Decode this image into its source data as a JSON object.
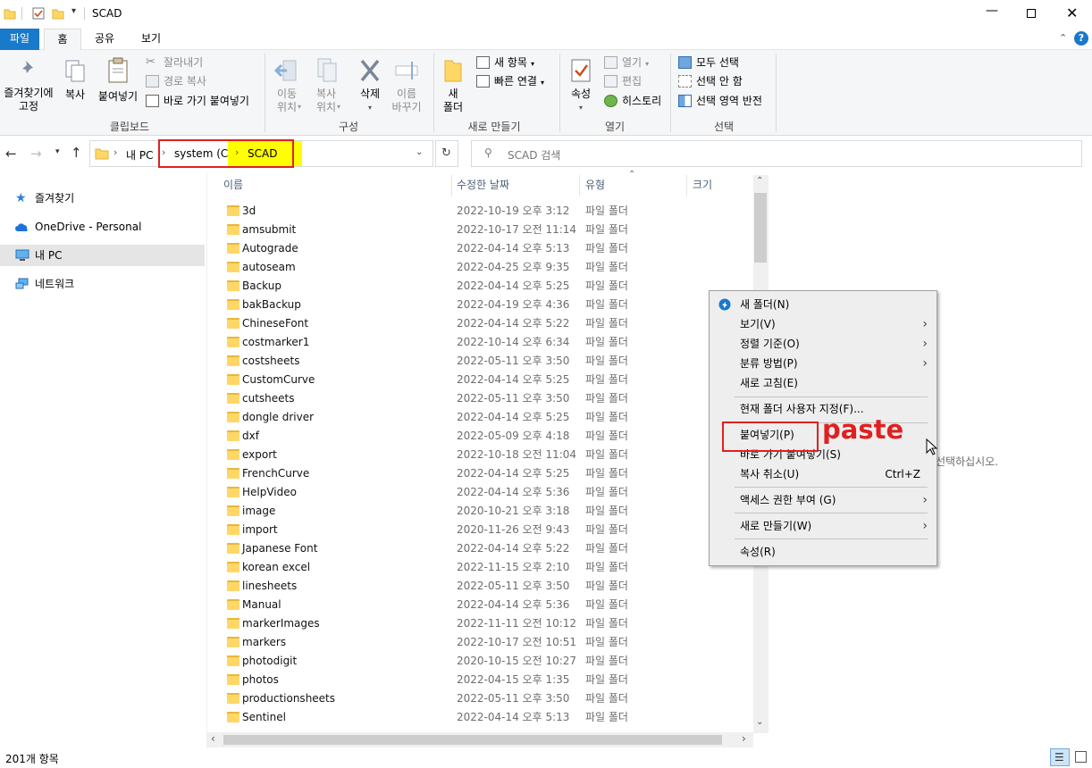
{
  "window": {
    "title": "SCAD"
  },
  "menu_tabs": [
    "파일",
    "홈",
    "공유",
    "보기"
  ],
  "ribbon": {
    "clipboard": {
      "pin": "즐겨찾기에\n고정",
      "copy": "복사",
      "paste": "붙여넣기",
      "cut": "잘라내기",
      "copy_path": "경로 복사",
      "paste_shortcut": "바로 가기 붙여넣기",
      "label": "클립보드"
    },
    "organize": {
      "move": "이동\n위치",
      "copy_to": "복사\n위치",
      "delete": "삭제",
      "rename": "이름\n바꾸기",
      "label": "구성"
    },
    "new": {
      "new_folder": "새\n폴더",
      "new_item": "새 항목",
      "easy_access": "빠른 연결",
      "label": "새로 만들기"
    },
    "open": {
      "properties": "속성",
      "open": "열기",
      "edit": "편집",
      "history": "히스토리",
      "label": "열기"
    },
    "select": {
      "select_all": "모두 선택",
      "select_none": "선택 안 함",
      "invert": "선택 영역 반전",
      "label": "선택"
    }
  },
  "address": {
    "pc": "내 PC",
    "drive": "system (C:)",
    "folder": "SCAD"
  },
  "search": {
    "placeholder": "SCAD 검색"
  },
  "sidebar": [
    {
      "label": "즐겨찾기",
      "icon": "star-icon"
    },
    {
      "label": "OneDrive - Personal",
      "icon": "cloud-icon"
    },
    {
      "label": "내 PC",
      "icon": "computer-icon"
    },
    {
      "label": "네트워크",
      "icon": "network-icon"
    }
  ],
  "columns": {
    "name": "이름",
    "date": "수정한 날짜",
    "type": "유형",
    "size": "크기"
  },
  "files": [
    {
      "name": "3d",
      "date": "2022-10-19 오후 3:12",
      "type": "파일 폴더"
    },
    {
      "name": "amsubmit",
      "date": "2022-10-17 오전 11:14",
      "type": "파일 폴더"
    },
    {
      "name": "Autograde",
      "date": "2022-04-14 오후 5:13",
      "type": "파일 폴더"
    },
    {
      "name": "autoseam",
      "date": "2022-04-25 오후 9:35",
      "type": "파일 폴더"
    },
    {
      "name": "Backup",
      "date": "2022-04-14 오후 5:25",
      "type": "파일 폴더"
    },
    {
      "name": "bakBackup",
      "date": "2022-04-19 오후 4:36",
      "type": "파일 폴더"
    },
    {
      "name": "ChineseFont",
      "date": "2022-04-14 오후 5:22",
      "type": "파일 폴더"
    },
    {
      "name": "costmarker1",
      "date": "2022-10-14 오후 6:34",
      "type": "파일 폴더"
    },
    {
      "name": "costsheets",
      "date": "2022-05-11 오후 3:50",
      "type": "파일 폴더"
    },
    {
      "name": "CustomCurve",
      "date": "2022-04-14 오후 5:25",
      "type": "파일 폴더"
    },
    {
      "name": "cutsheets",
      "date": "2022-05-11 오후 3:50",
      "type": "파일 폴더"
    },
    {
      "name": "dongle driver",
      "date": "2022-04-14 오후 5:25",
      "type": "파일 폴더"
    },
    {
      "name": "dxf",
      "date": "2022-05-09 오후 4:18",
      "type": "파일 폴더"
    },
    {
      "name": "export",
      "date": "2022-10-18 오전 11:04",
      "type": "파일 폴더"
    },
    {
      "name": "FrenchCurve",
      "date": "2022-04-14 오후 5:25",
      "type": "파일 폴더"
    },
    {
      "name": "HelpVideo",
      "date": "2022-04-14 오후 5:36",
      "type": "파일 폴더"
    },
    {
      "name": "image",
      "date": "2020-10-21 오후 3:18",
      "type": "파일 폴더"
    },
    {
      "name": "import",
      "date": "2020-11-26 오전 9:43",
      "type": "파일 폴더"
    },
    {
      "name": "Japanese Font",
      "date": "2022-04-14 오후 5:22",
      "type": "파일 폴더"
    },
    {
      "name": "korean excel",
      "date": "2022-11-15 오후 2:10",
      "type": "파일 폴더"
    },
    {
      "name": "linesheets",
      "date": "2022-05-11 오후 3:50",
      "type": "파일 폴더"
    },
    {
      "name": "Manual",
      "date": "2022-04-14 오후 5:36",
      "type": "파일 폴더"
    },
    {
      "name": "markerImages",
      "date": "2022-11-11 오전 10:12",
      "type": "파일 폴더"
    },
    {
      "name": "markers",
      "date": "2022-10-17 오전 10:51",
      "type": "파일 폴더"
    },
    {
      "name": "photodigit",
      "date": "2020-10-15 오전 10:27",
      "type": "파일 폴더"
    },
    {
      "name": "photos",
      "date": "2022-04-15 오후 1:35",
      "type": "파일 폴더"
    },
    {
      "name": "productionsheets",
      "date": "2022-05-11 오후 3:50",
      "type": "파일 폴더"
    },
    {
      "name": "Sentinel",
      "date": "2022-04-14 오후 5:13",
      "type": "파일 폴더"
    }
  ],
  "context_menu": [
    {
      "label": "새 폴더(N)",
      "icon": "new-folder-icon"
    },
    {
      "label": "보기(V)",
      "submenu": true
    },
    {
      "label": "정렬 기준(O)",
      "submenu": true
    },
    {
      "label": "분류 방법(P)",
      "submenu": true
    },
    {
      "label": "새로 고침(E)"
    },
    {
      "label": "현재 폴더 사용자 지정(F)..."
    },
    {
      "label": "붙여넣기(P)"
    },
    {
      "label": "바로 가기 붙여넣기(S)"
    },
    {
      "label": "복사 취소(U)",
      "shortcut": "Ctrl+Z"
    },
    {
      "label": "액세스 권한 부여 (G)",
      "submenu": true
    },
    {
      "label": "새로 만들기(W)",
      "submenu": true
    },
    {
      "label": "속성(R)"
    }
  ],
  "annotation": {
    "paste_label": "paste"
  },
  "preview_text": "선택하십시오.",
  "status": {
    "count": "201개 항목"
  },
  "colors": {
    "accent": "#1979ca",
    "folder": "#ffd766",
    "highlight_red": "#e02020",
    "highlight_yellow": "#ffff00"
  }
}
